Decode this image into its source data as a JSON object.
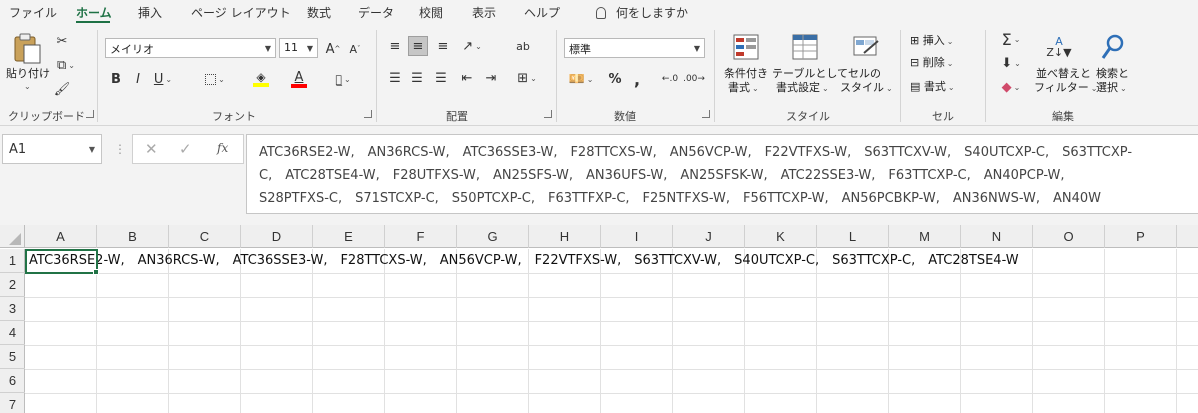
{
  "tabs": {
    "items": [
      "ファイル",
      "ホーム",
      "挿入",
      "ページ レイアウト",
      "数式",
      "データ",
      "校閲",
      "表示",
      "ヘルプ"
    ],
    "active": "ホーム",
    "tell_me": "何をしますか"
  },
  "ribbon": {
    "clipboard": {
      "paste": "貼り付け",
      "group": "クリップボード"
    },
    "font": {
      "name": "メイリオ",
      "size": "11",
      "grow": "A",
      "shrink": "A",
      "bold": "B",
      "italic": "I",
      "underline": "U",
      "font_color_letter": "A",
      "group": "フォント",
      "highlight_color": "#ffff00",
      "font_color": "#ff0000"
    },
    "alignment": {
      "group": "配置",
      "wrap": "ab"
    },
    "number": {
      "format": "標準",
      "percent": "%",
      "comma": ",",
      "group": "数値"
    },
    "styles": {
      "conditional": [
        "条件付き",
        "書式"
      ],
      "table": [
        "テーブルとして",
        "書式設定"
      ],
      "cell_styles": [
        "セルの",
        "スタイル"
      ],
      "group": "スタイル"
    },
    "cells": {
      "insert": "挿入",
      "delete": "削除",
      "format": "書式",
      "group": "セル"
    },
    "editing": {
      "sort": [
        "並べ替えと",
        "フィルター"
      ],
      "find": [
        "検索と",
        "選択"
      ],
      "group": "編集"
    }
  },
  "formula_bar": {
    "name_box": "A1",
    "fx": "fx",
    "lines": [
      "ATC36RSE2-W,　AN36RCS-W,　ATC36SSE3-W,　F28TTCXS-W,　AN56VCP-W,　F22VTFXS-W,　S63TTCXV-W,　S40UTCXP-C,　S63TTCXP-",
      "C,　ATC28TSE4-W,　F28UTFXS-W,　AN25SFS-W,　AN36UFS-W,　AN25SFSK-W,　ATC22SSE3-W,　F63TTCXP-C,　AN40PCP-W,",
      "S28PTFXS-C,　S71STCXP-C,　S50PTCXP-C,　F63TTFXP-C,　F25NTFXS-W,　F56TTCXP-W,　AN56PCBKP-W,　AN36NWS-W,　AN40W"
    ]
  },
  "sheet": {
    "columns": [
      "A",
      "B",
      "C",
      "D",
      "E",
      "F",
      "G",
      "H",
      "I",
      "J",
      "K",
      "L",
      "M",
      "N",
      "O",
      "P"
    ],
    "rows": [
      "1",
      "2",
      "3",
      "4",
      "5",
      "6",
      "7"
    ],
    "a1_value": "ATC36RSE2-W,　AN36RCS-W,　ATC36SSE3-W,　F28TTCXS-W,　AN56VCP-W,　F22VTFXS-W,　S63TTCXV-W,　S40UTCXP-C,　S63TTCXP-C,　ATC28TSE4-W",
    "accent": "#217346"
  }
}
